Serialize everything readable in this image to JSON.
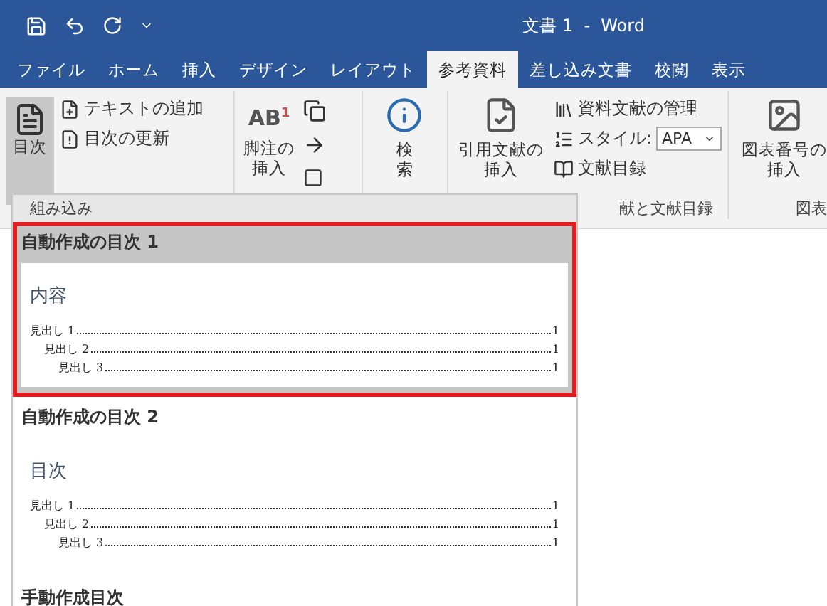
{
  "title_bar": {
    "title": "文書 1  -  Word"
  },
  "tabs": [
    {
      "label": "ファイル",
      "selected": false
    },
    {
      "label": "ホーム",
      "selected": false
    },
    {
      "label": "挿入",
      "selected": false
    },
    {
      "label": "デザイン",
      "selected": false
    },
    {
      "label": "レイアウト",
      "selected": false
    },
    {
      "label": "参考資料",
      "selected": true
    },
    {
      "label": "差し込み文書",
      "selected": false
    },
    {
      "label": "校閲",
      "selected": false
    },
    {
      "label": "表示",
      "selected": false
    }
  ],
  "ribbon": {
    "toc_group": {
      "large_button": "目次",
      "small_buttons": [
        "テキストの追加",
        "目次の更新"
      ]
    },
    "footnote_group": {
      "large_button": "脚注の挿入",
      "icon_text": "AB",
      "icon_mark": "1"
    },
    "search_group": {
      "large_button": "検索"
    },
    "citation_group": {
      "large_button": "引用文献の挿入",
      "manage": "資料文献の管理",
      "style_label": "スタイル:",
      "style_value": "APA",
      "bibliography": "文献目録",
      "label": "献と文献目録"
    },
    "caption_group": {
      "large_button": "図表番号の挿入",
      "label": "図表"
    }
  },
  "dropdown": {
    "section": "組み込み",
    "items": [
      {
        "title": "自動作成の目次 1",
        "selected": true,
        "heading": "内容",
        "entries": [
          {
            "text": "見出し 1",
            "page": "1",
            "children": [
              {
                "text": "見出し 2",
                "page": "1",
                "children": [
                  {
                    "text": "見出し 3",
                    "page": "1"
                  }
                ]
              }
            ]
          }
        ]
      },
      {
        "title": "自動作成の目次 2",
        "selected": false,
        "heading": "目次",
        "entries": [
          {
            "text": "見出し 1",
            "page": "1",
            "children": [
              {
                "text": "見出し 2",
                "page": "1",
                "children": [
                  {
                    "text": "見出し 3",
                    "page": "1"
                  }
                ]
              }
            ]
          }
        ]
      }
    ],
    "next_item": "手動作成目次"
  }
}
